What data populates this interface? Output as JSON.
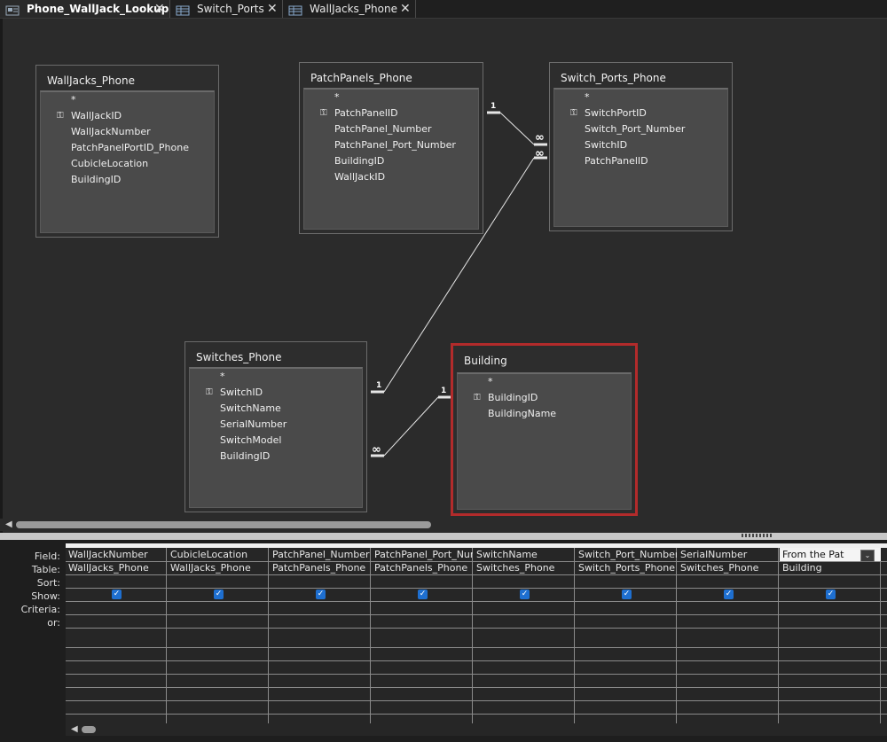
{
  "tabs": [
    {
      "label": "Phone_WallJack_Lookup",
      "icon": "query-icon",
      "active": true
    },
    {
      "label": "Switch_Ports",
      "icon": "table-icon",
      "active": false
    },
    {
      "label": "WallJacks_Phone",
      "icon": "table-icon",
      "active": false
    }
  ],
  "tables": {
    "walljacks": {
      "title": "WallJacks_Phone",
      "star": "*",
      "fields": [
        "WallJackID",
        "WallJackNumber",
        "PatchPanelPortID_Phone",
        "CubicleLocation",
        "BuildingID"
      ]
    },
    "patchpanels": {
      "title": "PatchPanels_Phone",
      "star": "*",
      "fields": [
        "PatchPanelID",
        "PatchPanel_Number",
        "PatchPanel_Port_Number",
        "BuildingID",
        "WallJackID"
      ]
    },
    "switchports": {
      "title": "Switch_Ports_Phone",
      "star": "*",
      "fields": [
        "SwitchPortID",
        "Switch_Port_Number",
        "SwitchID",
        "PatchPanelID"
      ]
    },
    "switches": {
      "title": "Switches_Phone",
      "star": "*",
      "fields": [
        "SwitchID",
        "SwitchName",
        "SerialNumber",
        "SwitchModel",
        "BuildingID"
      ]
    },
    "building": {
      "title": "Building",
      "star": "*",
      "fields": [
        "BuildingID",
        "BuildingName"
      ]
    }
  },
  "relationships": {
    "one": "1",
    "many": "∞"
  },
  "grid": {
    "row_labels": {
      "field": "Field:",
      "table": "Table:",
      "sort": "Sort:",
      "show": "Show:",
      "criteria": "Criteria:",
      "or": "or:"
    },
    "columns": [
      {
        "field": "WallJackNumber",
        "table": "WallJacks_Phone",
        "show": true
      },
      {
        "field": "CubicleLocation",
        "table": "WallJacks_Phone",
        "show": true
      },
      {
        "field": "PatchPanel_Number",
        "table": "PatchPanels_Phone",
        "show": true
      },
      {
        "field": "PatchPanel_Port_Num",
        "table": "PatchPanels_Phone",
        "show": true
      },
      {
        "field": "SwitchName",
        "table": "Switches_Phone",
        "show": true
      },
      {
        "field": "Switch_Port_Number",
        "table": "Switch_Ports_Phone",
        "show": true
      },
      {
        "field": "SerialNumber",
        "table": "Switches_Phone",
        "show": true
      },
      {
        "field": "From the Pat",
        "table": "Building",
        "show": true
      }
    ]
  }
}
